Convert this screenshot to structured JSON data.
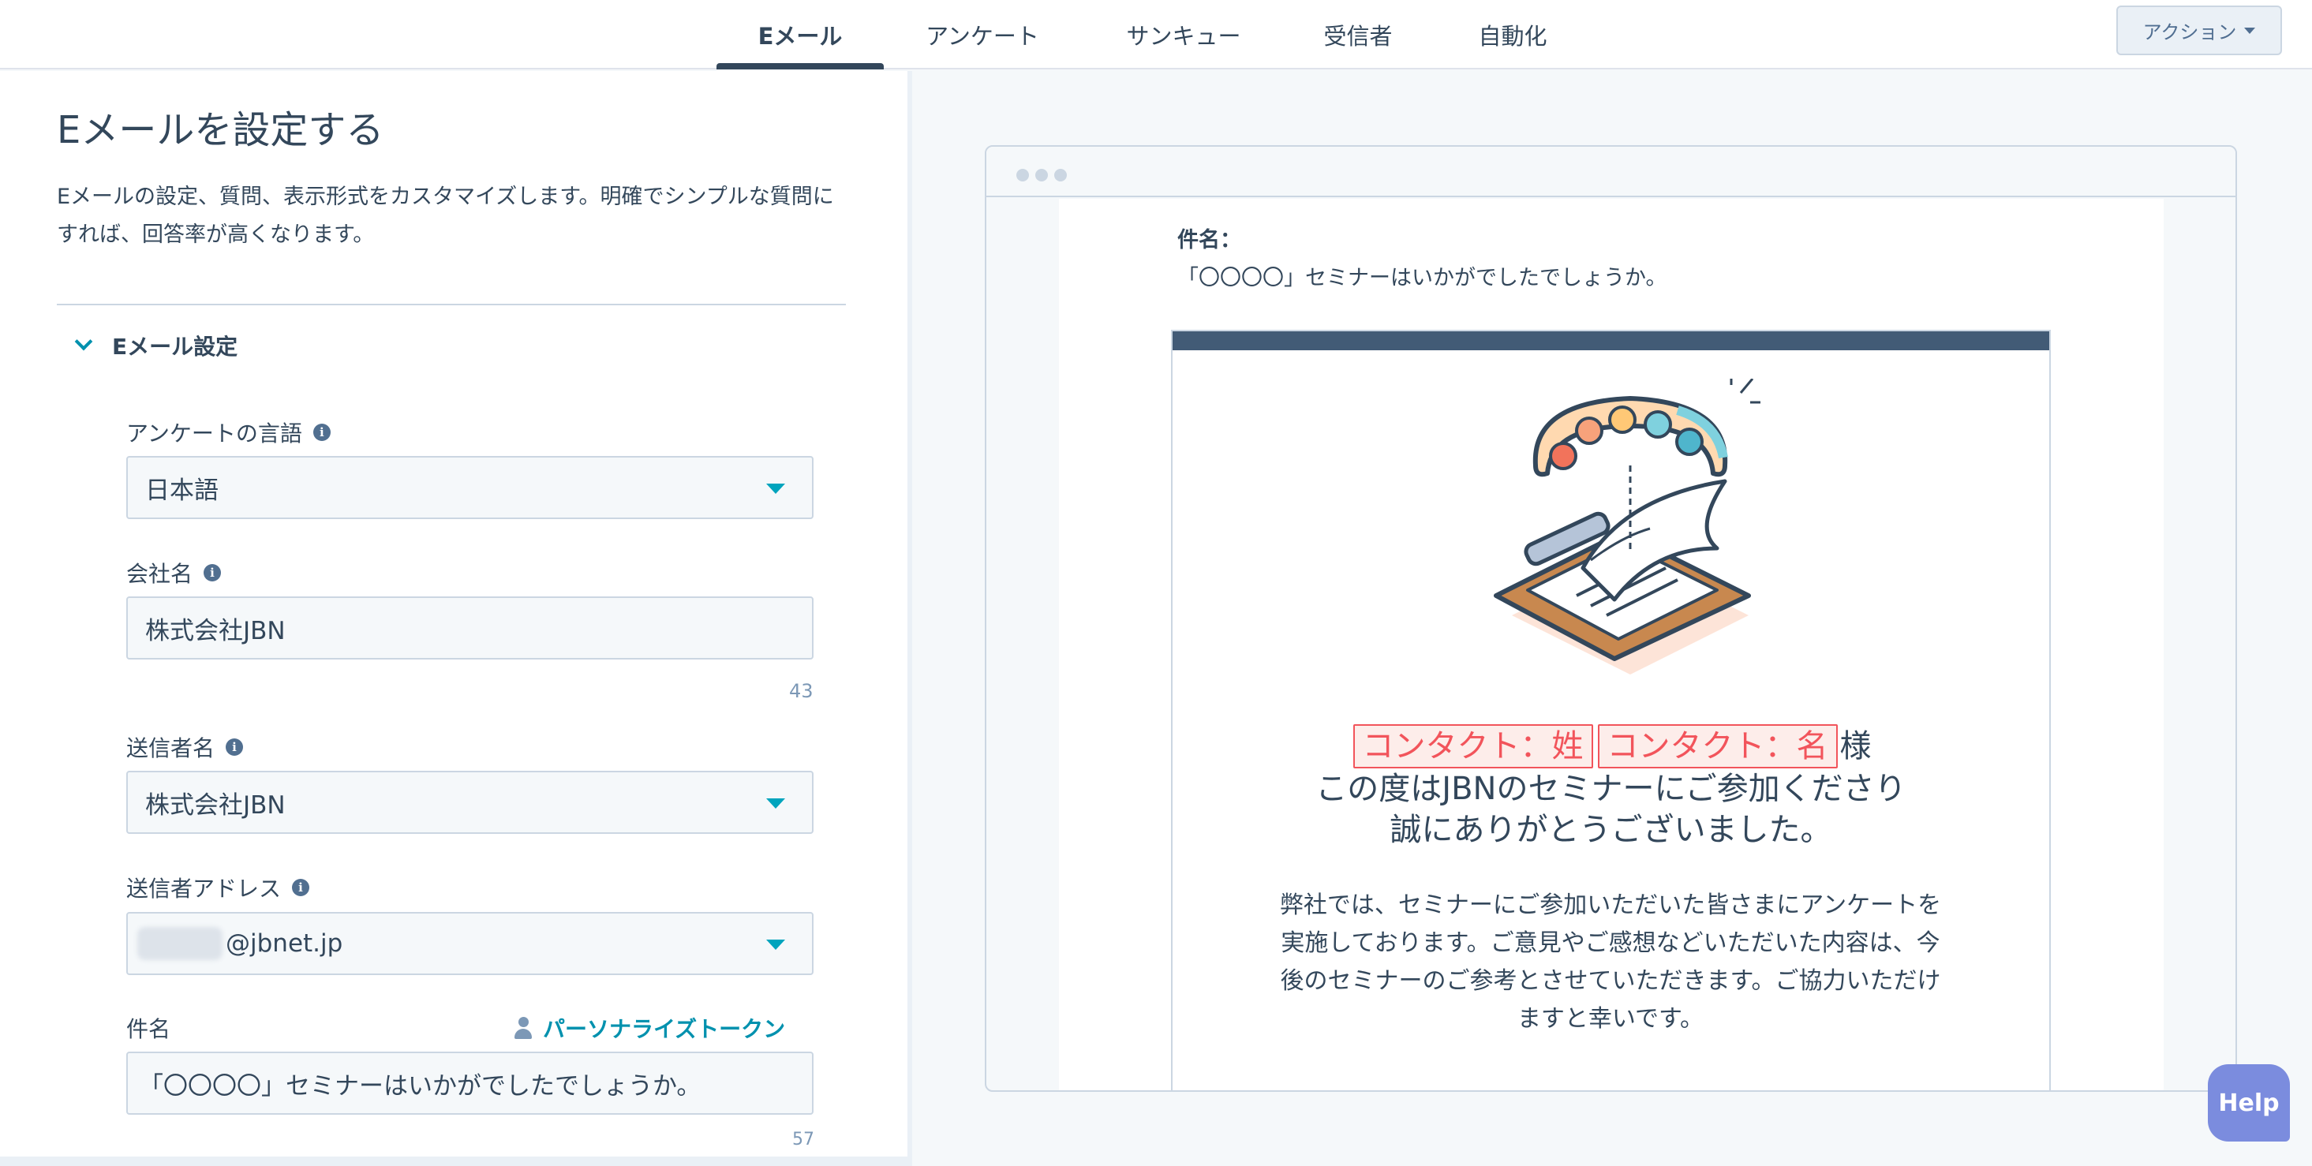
{
  "nav": {
    "tabs": [
      {
        "label": "Eメール",
        "active": true
      },
      {
        "label": "アンケート"
      },
      {
        "label": "サンキュー"
      },
      {
        "label": "受信者"
      },
      {
        "label": "自動化"
      }
    ],
    "action_label": "アクション"
  },
  "panel": {
    "title": "Eメールを設定する",
    "description": "Eメールの設定、質問、表示形式をカスタマイズします。明確でシンプルな質問にすれば、回答率が高くなります。",
    "section_label": "Eメール設定",
    "fields": {
      "language": {
        "label": "アンケートの言語",
        "value": "日本語"
      },
      "company": {
        "label": "会社名",
        "value": "株式会社JBN",
        "remaining": "43"
      },
      "sender_name": {
        "label": "送信者名",
        "value": "株式会社JBN"
      },
      "sender_address": {
        "label": "送信者アドレス",
        "value": "@jbnet.jp"
      },
      "subject": {
        "label": "件名",
        "value": "「〇〇〇〇」セミナーはいかがでしたでしょうか。",
        "remaining": "57",
        "token_link": "パーソナライズトークン"
      }
    }
  },
  "preview": {
    "subject_label": "件名：",
    "subject_value": "「〇〇〇〇」セミナーはいかがでしたでしょうか。",
    "token_last_name": "コンタクト：姓",
    "token_first_name": "コンタクト：名",
    "honorific": "様",
    "greeting_line2": "この度はJBNのセミナーにご参加くださり",
    "greeting_line3": "誠にありがとうございました。",
    "body_text": "弊社では、セミナーにご参加いただいた皆さまにアンケートを実施しております。ご意見やご感想などいただいた内容は、今後のセミナーのご参考とさせていただきます。ご協力いただけますと幸いです。"
  },
  "help_label": "Help",
  "colors": {
    "accent_teal": "#00a4bd",
    "token_red": "#f2545b",
    "navy": "#425b76",
    "help_purple": "#7b8cde"
  },
  "icons": [
    "info-icon",
    "chevron-down-icon",
    "dropdown-arrow-icon",
    "person-icon",
    "survey-illustration"
  ]
}
